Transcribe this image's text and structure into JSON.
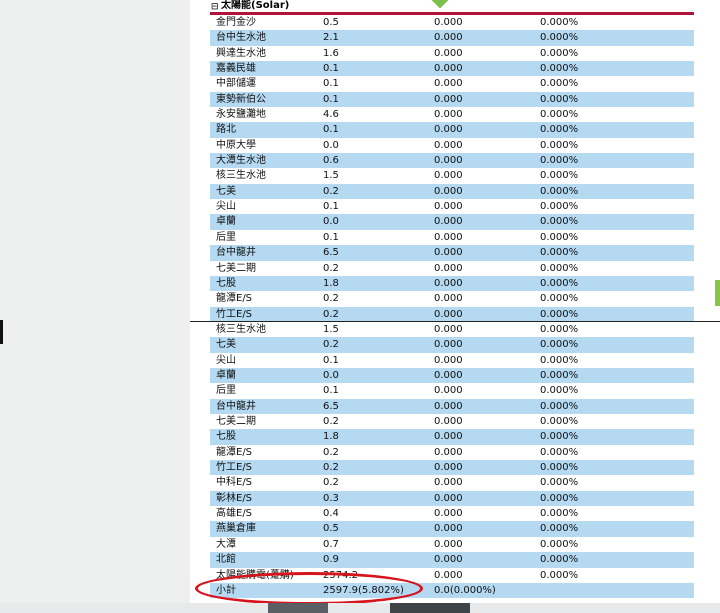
{
  "section": {
    "title": "太陽能(Solar)",
    "expand_icon": "minus-box-icon"
  },
  "top_rows": [
    {
      "name": "金門金沙",
      "value": "0.5",
      "pct": "0.000",
      "rate": "0.000%"
    },
    {
      "name": "台中生水池",
      "value": "2.1",
      "pct": "0.000",
      "rate": "0.000%"
    },
    {
      "name": "興達生水池",
      "value": "1.6",
      "pct": "0.000",
      "rate": "0.000%"
    },
    {
      "name": "嘉義民雄",
      "value": "0.1",
      "pct": "0.000",
      "rate": "0.000%"
    },
    {
      "name": "中部儲運",
      "value": "0.1",
      "pct": "0.000",
      "rate": "0.000%"
    },
    {
      "name": "東勢新伯公",
      "value": "0.1",
      "pct": "0.000",
      "rate": "0.000%"
    },
    {
      "name": "永安鹽灘地",
      "value": "4.6",
      "pct": "0.000",
      "rate": "0.000%"
    },
    {
      "name": "路北",
      "value": "0.1",
      "pct": "0.000",
      "rate": "0.000%"
    },
    {
      "name": "中原大學",
      "value": "0.0",
      "pct": "0.000",
      "rate": "0.000%"
    },
    {
      "name": "大潭生水池",
      "value": "0.6",
      "pct": "0.000",
      "rate": "0.000%"
    },
    {
      "name": "核三生水池",
      "value": "1.5",
      "pct": "0.000",
      "rate": "0.000%"
    },
    {
      "name": "七美",
      "value": "0.2",
      "pct": "0.000",
      "rate": "0.000%"
    },
    {
      "name": "尖山",
      "value": "0.1",
      "pct": "0.000",
      "rate": "0.000%"
    },
    {
      "name": "卓蘭",
      "value": "0.0",
      "pct": "0.000",
      "rate": "0.000%"
    },
    {
      "name": "后里",
      "value": "0.1",
      "pct": "0.000",
      "rate": "0.000%"
    },
    {
      "name": "台中龍井",
      "value": "6.5",
      "pct": "0.000",
      "rate": "0.000%"
    },
    {
      "name": "七美二期",
      "value": "0.2",
      "pct": "0.000",
      "rate": "0.000%"
    },
    {
      "name": "七股",
      "value": "1.8",
      "pct": "0.000",
      "rate": "0.000%"
    },
    {
      "name": "龍潭E/S",
      "value": "0.2",
      "pct": "0.000",
      "rate": "0.000%"
    },
    {
      "name": "竹工E/S",
      "value": "0.2",
      "pct": "0.000",
      "rate": "0.000%"
    }
  ],
  "bottom_rows": [
    {
      "name": "核三生水池",
      "value": "1.5",
      "pct": "0.000",
      "rate": "0.000%"
    },
    {
      "name": "七美",
      "value": "0.2",
      "pct": "0.000",
      "rate": "0.000%"
    },
    {
      "name": "尖山",
      "value": "0.1",
      "pct": "0.000",
      "rate": "0.000%"
    },
    {
      "name": "卓蘭",
      "value": "0.0",
      "pct": "0.000",
      "rate": "0.000%"
    },
    {
      "name": "后里",
      "value": "0.1",
      "pct": "0.000",
      "rate": "0.000%"
    },
    {
      "name": "台中龍井",
      "value": "6.5",
      "pct": "0.000",
      "rate": "0.000%"
    },
    {
      "name": "七美二期",
      "value": "0.2",
      "pct": "0.000",
      "rate": "0.000%"
    },
    {
      "name": "七股",
      "value": "1.8",
      "pct": "0.000",
      "rate": "0.000%"
    },
    {
      "name": "龍潭E/S",
      "value": "0.2",
      "pct": "0.000",
      "rate": "0.000%"
    },
    {
      "name": "竹工E/S",
      "value": "0.2",
      "pct": "0.000",
      "rate": "0.000%"
    },
    {
      "name": "中科E/S",
      "value": "0.2",
      "pct": "0.000",
      "rate": "0.000%"
    },
    {
      "name": "彰林E/S",
      "value": "0.3",
      "pct": "0.000",
      "rate": "0.000%"
    },
    {
      "name": "高雄E/S",
      "value": "0.4",
      "pct": "0.000",
      "rate": "0.000%"
    },
    {
      "name": "燕巢倉庫",
      "value": "0.5",
      "pct": "0.000",
      "rate": "0.000%"
    },
    {
      "name": "大潭",
      "value": "0.7",
      "pct": "0.000",
      "rate": "0.000%"
    },
    {
      "name": "北館",
      "value": "0.9",
      "pct": "0.000",
      "rate": "0.000%"
    },
    {
      "name": "太陽能購電(躉購)",
      "value": "2574.2",
      "pct": "0.000",
      "rate": "0.000%"
    }
  ],
  "subtotal": {
    "label": "小計",
    "value": "2597.9(5.802%)",
    "pct": "0.0(0.000%)"
  },
  "colors": {
    "row_highlight": "#b4d9f1",
    "header_bar": "#b0123c",
    "annotation_oval": "#d6141c",
    "marker_green": "#7cc04b"
  }
}
